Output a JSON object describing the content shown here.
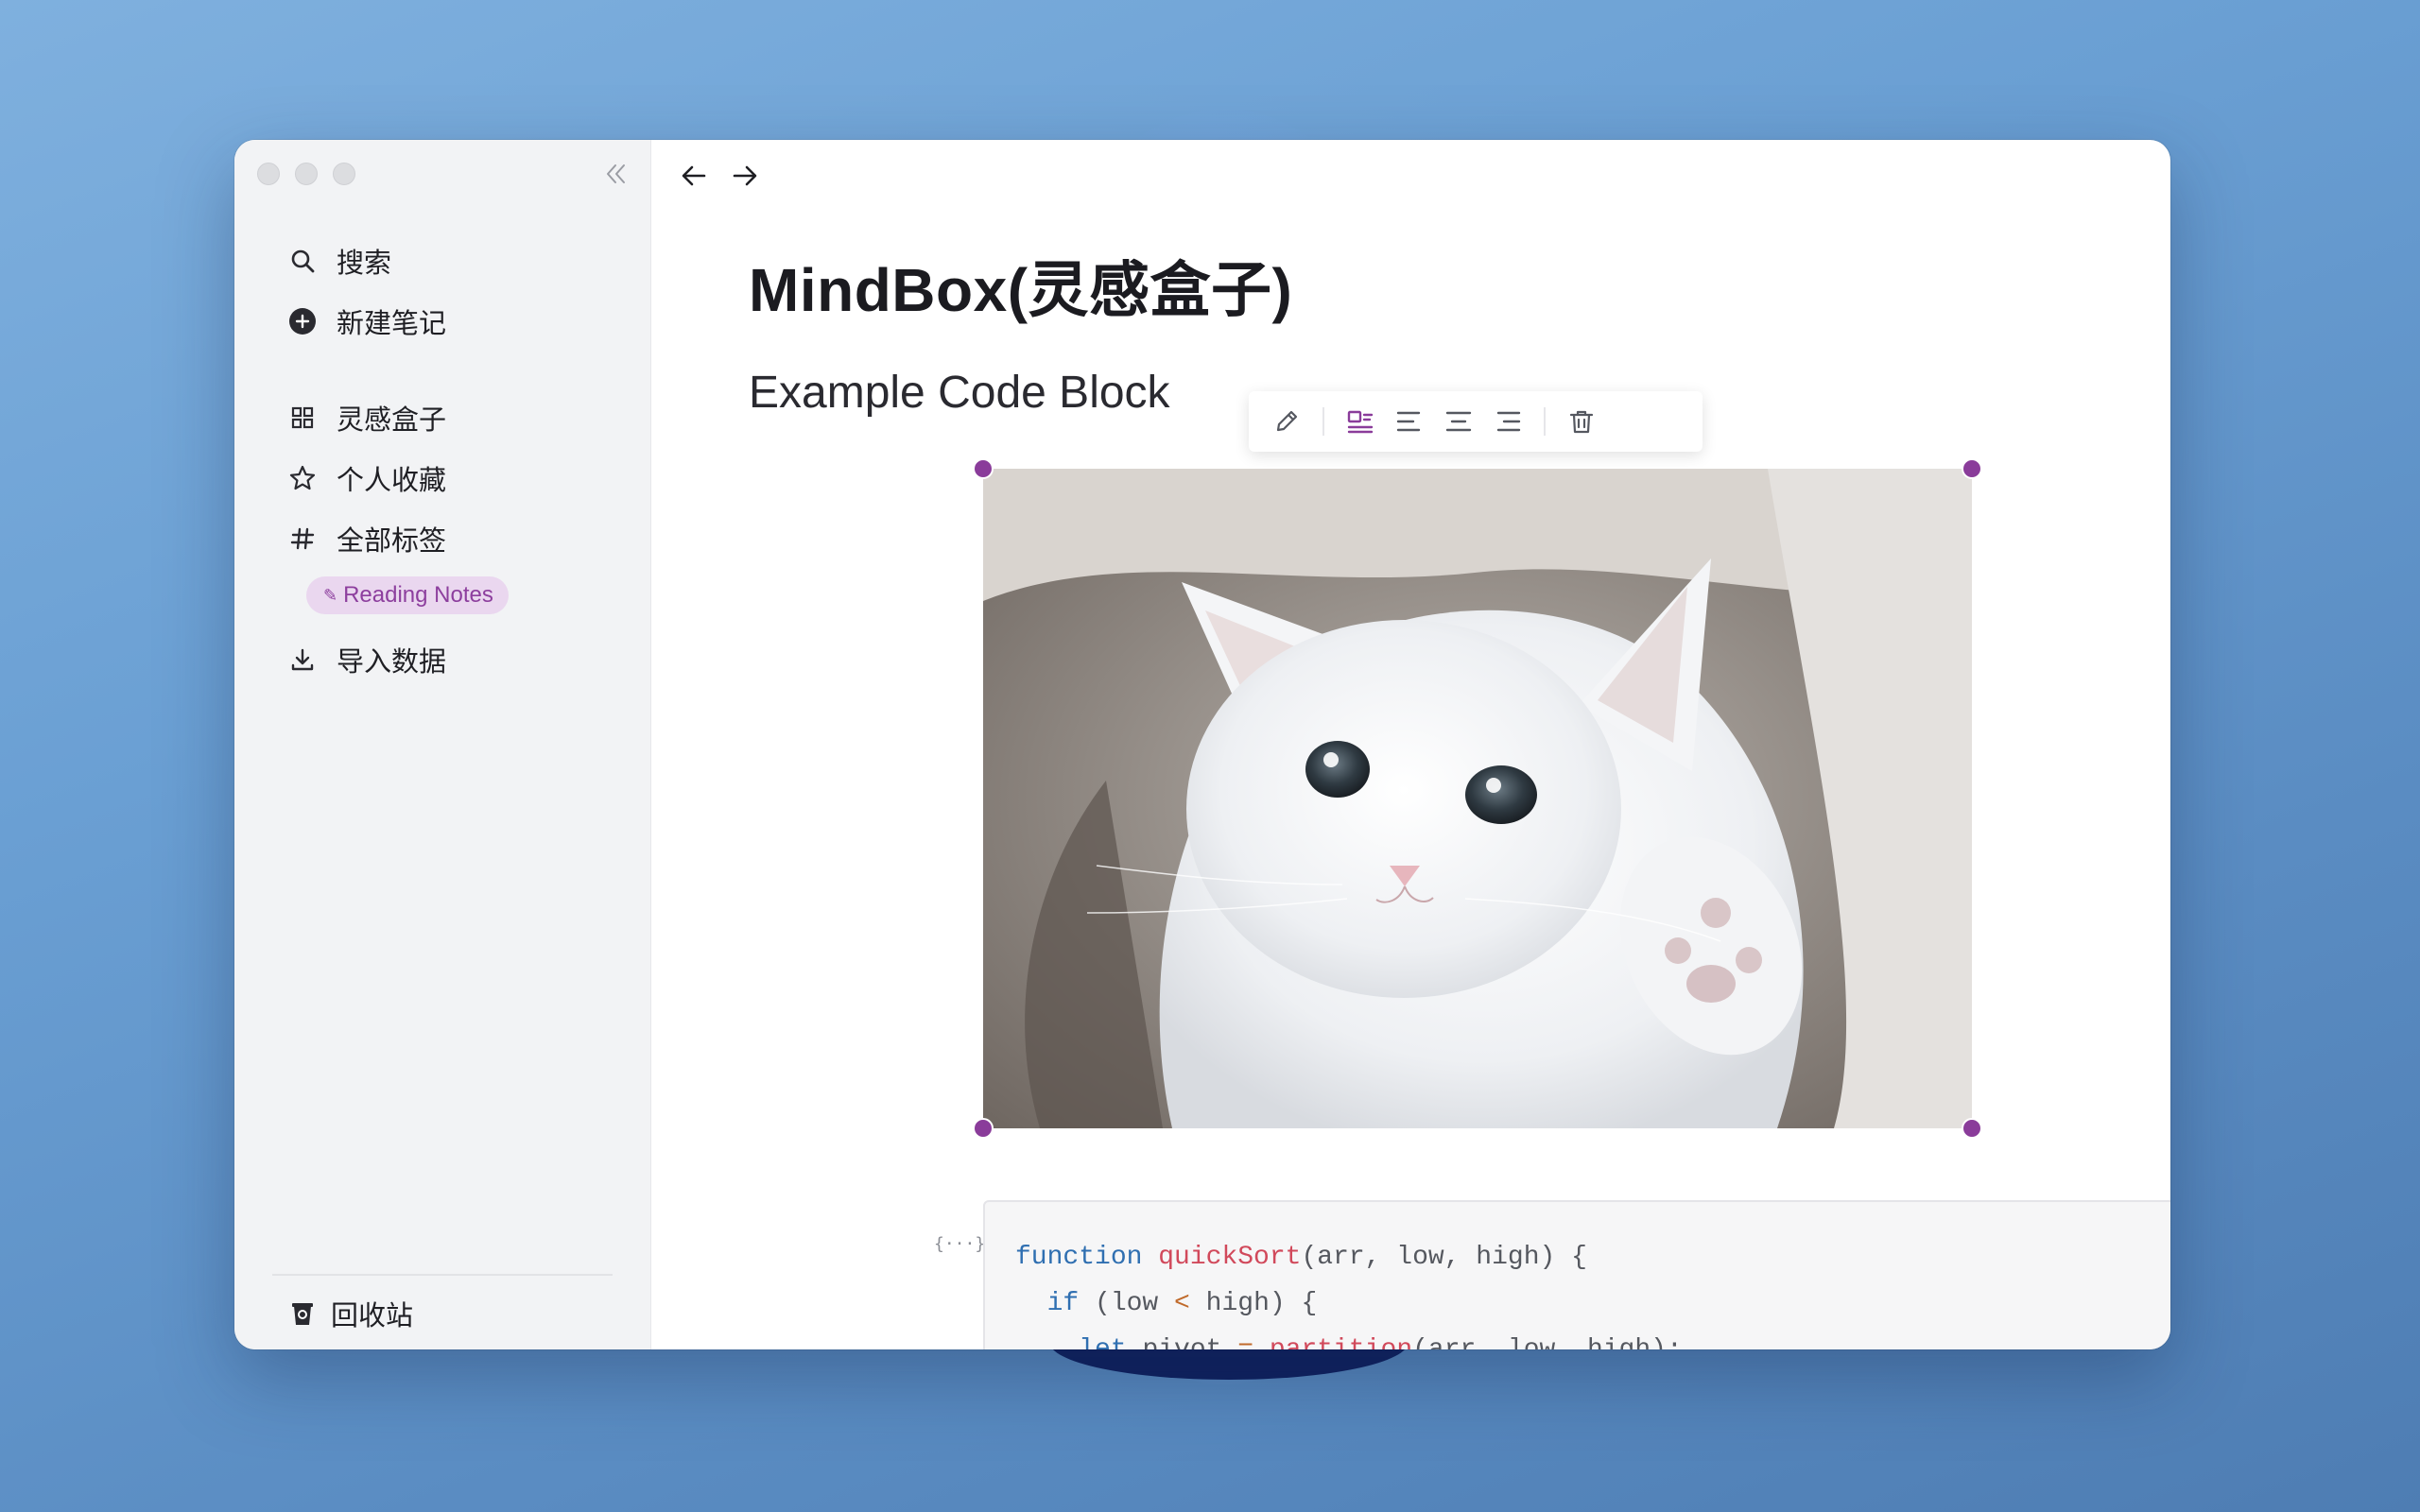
{
  "window": {
    "title": "MindBox(灵感盒子)"
  },
  "sidebar": {
    "search_label": "搜索",
    "new_note_label": "新建笔记",
    "items": [
      {
        "label": "灵感盒子",
        "icon": "grid-icon"
      },
      {
        "label": "个人收藏",
        "icon": "star-icon"
      },
      {
        "label": "全部标签",
        "icon": "hash-icon"
      }
    ],
    "tag": {
      "label": "Reading Notes",
      "icon": "pen-icon"
    },
    "import_label": "导入数据",
    "trash_label": "回收站"
  },
  "document": {
    "title": "MindBox(灵感盒子)",
    "heading": "Example Code Block",
    "image_alt": "white kitten",
    "code_icon_text": "{···}",
    "code_lines": [
      "function quickSort(arr, low, high) {",
      "  if (low < high) {",
      "    let pivot = partition(arr, low, high);"
    ]
  },
  "colors": {
    "accent": "#8a3c9a",
    "tag_bg": "#ead7ef",
    "sidebar_bg": "#f2f3f5"
  }
}
